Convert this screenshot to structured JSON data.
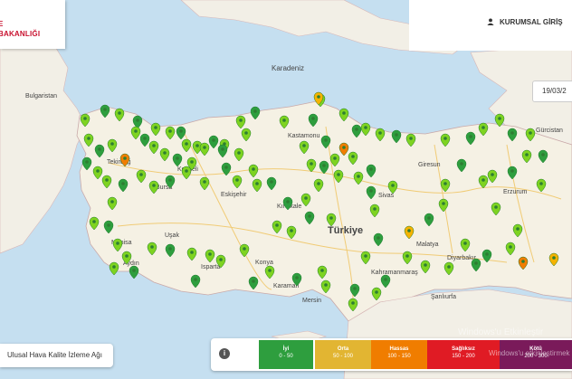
{
  "header": {
    "logo_line1": "E",
    "logo_line2": "BAKANLIĞI",
    "login_label": "KURUMSAL GİRİŞ",
    "date": "19/03/2"
  },
  "map": {
    "labels": {
      "karadeniz": "Karadeniz",
      "bulgaristan": "Bulgaristan",
      "gurcistan": "Gürcistan",
      "turkiye": "Türkiye",
      "kastamonu": "Kastamonu",
      "tekirdag": "Tekirdağ",
      "bursa": "Bursa",
      "kocaeli": "Kocaeli",
      "eskisehir": "Eskişehir",
      "kirikkale": "Kırıkkale",
      "manisa": "Manisa",
      "usak": "Uşak",
      "aydin": "Aydın",
      "isparta": "Isparta",
      "konya": "Konya",
      "karaman": "Karaman",
      "mersin": "Mersin",
      "kahramanmaras": "Kahramanmaraş",
      "sanliurfa": "Şanlıurfa",
      "diyarbakir": "Diyarbakır",
      "malatya": "Malatya",
      "sivas": "Sivas",
      "giresun": "Giresun",
      "erzurum": "Erzurum"
    },
    "marker_colors": {
      "iyi": "#2e9e3e",
      "iyi_light": "#7ed321",
      "orta": "#f5b301",
      "hassas": "#f07d00"
    }
  },
  "network_label": "Ulusal Hava Kalite İzleme Ağı",
  "legend": {
    "info_icon": "i",
    "items": [
      {
        "name": "İyi",
        "range": "0 - 50",
        "color": "#2e9e3e"
      },
      {
        "name": "Orta",
        "range": "50 - 100",
        "color": "#e2b532"
      },
      {
        "name": "Hassas",
        "range": "100 - 150",
        "color": "#f07d00"
      },
      {
        "name": "Sağlıksız",
        "range": "150 - 200",
        "color": "#e01b24"
      },
      {
        "name": "Kötü",
        "range": "200 - 300",
        "color": "#7a1a5a"
      }
    ]
  },
  "watermark": {
    "line1": "Windows'u Etkinleştir",
    "line2": "Windows'u etkinleştirmek"
  }
}
